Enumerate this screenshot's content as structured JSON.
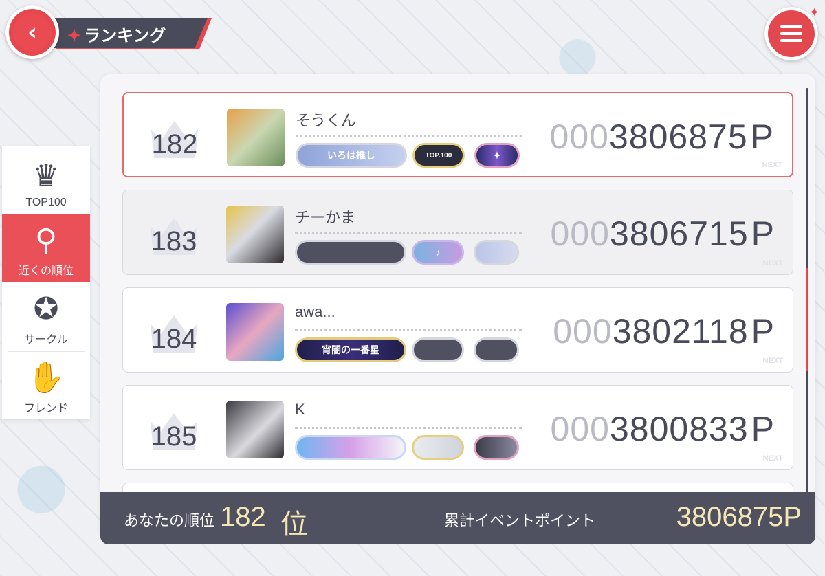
{
  "header": {
    "title": "ランキング",
    "title_star": "✦",
    "back_icon": "back-arrow-icon",
    "menu_icon": "list-menu-icon"
  },
  "sidebar": {
    "items": [
      {
        "label": "TOP100",
        "icon": "crown-icon",
        "glyph": "♛",
        "active": false
      },
      {
        "label": "近くの順位",
        "icon": "nearby-ranking-icon",
        "glyph": "⛼",
        "active": true
      },
      {
        "label": "サークル",
        "icon": "circle-emblem-icon",
        "glyph": "✪",
        "active": false
      },
      {
        "label": "フレンド",
        "icon": "handshake-icon",
        "glyph": "🤝",
        "active": false
      }
    ]
  },
  "rows": [
    {
      "rank": "182",
      "name": "そうくん",
      "score_zeros": "000",
      "score": "3806875",
      "unit": "P",
      "badge_text": "いろは推し",
      "badge2_text": "TOP.100",
      "highlight": true
    },
    {
      "rank": "183",
      "name": "チーかま",
      "score_zeros": "000",
      "score": "3806715",
      "unit": "P",
      "badge_text": "",
      "badge2_text": "",
      "highlight": false
    },
    {
      "rank": "184",
      "name": "awa...",
      "score_zeros": "000",
      "score": "3802118",
      "unit": "P",
      "badge_text": "宵闇の一番星",
      "badge2_text": "",
      "highlight": false
    },
    {
      "rank": "185",
      "name": "K",
      "score_zeros": "000",
      "score": "3800833",
      "unit": "P",
      "badge_text": "",
      "badge2_text": "",
      "highlight": false
    }
  ],
  "next_label": "NEXT",
  "footer": {
    "my_rank_label": "あなたの順位",
    "my_rank": "182",
    "my_rank_unit": "位",
    "points_label": "累計イベントポイント",
    "points": "3806875P"
  },
  "colors": {
    "accent": "#e3484f",
    "dark": "#4a4b5a",
    "gold": "#f5e7b5"
  }
}
